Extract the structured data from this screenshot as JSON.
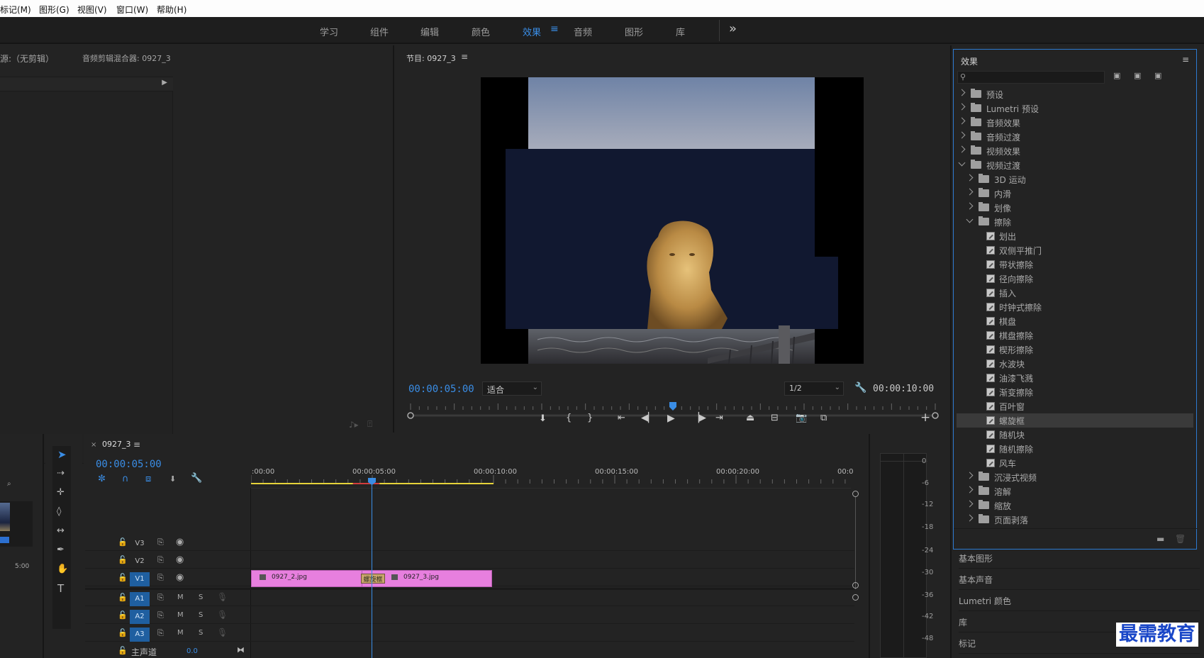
{
  "menu": [
    "标记(M)",
    "图形(G)",
    "视图(V)",
    "窗口(W)",
    "帮助(H)"
  ],
  "workspaces": [
    "学习",
    "组件",
    "编辑",
    "颜色",
    "效果",
    "音频",
    "图形",
    "库"
  ],
  "workspace_overflow": "»",
  "source": {
    "tab1": "源:（无剪辑）",
    "tab2": "音频剪辑混合器: 0927_3"
  },
  "program": {
    "title": "节目: 0927_3",
    "timecode": "00:00:05:00",
    "fit": "适合",
    "resolution": "1/2",
    "duration": "00:00:10:00"
  },
  "effects": {
    "title": "效果",
    "tree": [
      {
        "label": "预设",
        "kind": "folder",
        "level": 0,
        "open": false
      },
      {
        "label": "Lumetri 预设",
        "kind": "folder",
        "level": 0,
        "open": false
      },
      {
        "label": "音频效果",
        "kind": "folder",
        "level": 0,
        "open": false
      },
      {
        "label": "音频过渡",
        "kind": "folder",
        "level": 0,
        "open": false
      },
      {
        "label": "视频效果",
        "kind": "folder",
        "level": 0,
        "open": false
      },
      {
        "label": "视频过渡",
        "kind": "folder",
        "level": 0,
        "open": true
      },
      {
        "label": "3D 运动",
        "kind": "folder",
        "level": 1,
        "open": false
      },
      {
        "label": "内滑",
        "kind": "folder",
        "level": 1,
        "open": false
      },
      {
        "label": "划像",
        "kind": "folder",
        "level": 1,
        "open": false
      },
      {
        "label": "擦除",
        "kind": "folder",
        "level": 1,
        "open": true
      },
      {
        "label": "划出",
        "kind": "effect",
        "level": 2
      },
      {
        "label": "双侧平推门",
        "kind": "effect",
        "level": 2
      },
      {
        "label": "带状擦除",
        "kind": "effect",
        "level": 2
      },
      {
        "label": "径向擦除",
        "kind": "effect",
        "level": 2
      },
      {
        "label": "插入",
        "kind": "effect",
        "level": 2
      },
      {
        "label": "时钟式擦除",
        "kind": "effect",
        "level": 2
      },
      {
        "label": "棋盘",
        "kind": "effect",
        "level": 2
      },
      {
        "label": "棋盘擦除",
        "kind": "effect",
        "level": 2
      },
      {
        "label": "楔形擦除",
        "kind": "effect",
        "level": 2
      },
      {
        "label": "水波块",
        "kind": "effect",
        "level": 2
      },
      {
        "label": "油漆飞溅",
        "kind": "effect",
        "level": 2
      },
      {
        "label": "渐变擦除",
        "kind": "effect",
        "level": 2
      },
      {
        "label": "百叶窗",
        "kind": "effect",
        "level": 2
      },
      {
        "label": "螺旋框",
        "kind": "effect",
        "level": 2,
        "selected": true
      },
      {
        "label": "随机块",
        "kind": "effect",
        "level": 2
      },
      {
        "label": "随机擦除",
        "kind": "effect",
        "level": 2
      },
      {
        "label": "风车",
        "kind": "effect",
        "level": 2
      },
      {
        "label": "沉浸式视频",
        "kind": "folder",
        "level": 1,
        "open": false
      },
      {
        "label": "溶解",
        "kind": "folder",
        "level": 1,
        "open": false
      },
      {
        "label": "缩放",
        "kind": "folder",
        "level": 1,
        "open": false
      },
      {
        "label": "页面剥落",
        "kind": "folder",
        "level": 1,
        "open": false
      }
    ]
  },
  "side_panels": [
    "基本图形",
    "基本声音",
    "Lumetri 颜色",
    "库",
    "标记"
  ],
  "timeline": {
    "sequence": "0927_3",
    "timecode": "00:00:05:00",
    "ruler": [
      ":00:00",
      "00:00:05:00",
      "00:00:10:00",
      "00:00:15:00",
      "00:00:20:00",
      "00:0"
    ],
    "video_tracks": [
      "V3",
      "V2",
      "V1"
    ],
    "audio_tracks": [
      "A1",
      "A2",
      "A3"
    ],
    "master_label": "主声道",
    "master_value": "0.0",
    "clips": [
      "0927_2.jpg",
      "0927_3.jpg"
    ],
    "transition_label": "螺旋框",
    "thumb_time": "5:00"
  },
  "meter_db": [
    "0",
    "-6",
    "-12",
    "-18",
    "-24",
    "-30",
    "-36",
    "-42",
    "-48"
  ],
  "watermark": "最需教育",
  "colors": {
    "accent": "#3a8de5",
    "clip": "#e77fde",
    "playhead": "#3a8de5"
  }
}
